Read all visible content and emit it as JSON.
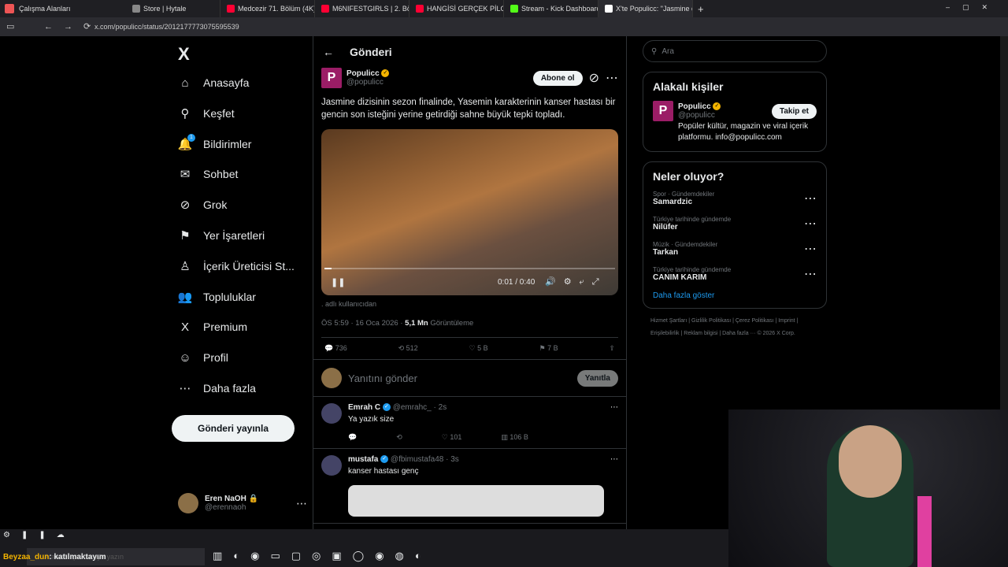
{
  "browser": {
    "workspaces_label": "Çalışma Alanları",
    "tabs": [
      {
        "label": "Store | Hytale",
        "color": "#888888"
      },
      {
        "label": "Medcezir 71. Bölüm (4K) - Y",
        "color": "#ff0033"
      },
      {
        "label": "M6NIFESTGIRLS | 2. Bölüm",
        "color": "#ff0033"
      },
      {
        "label": "HANGİSİ GERÇEK PİLOT?! ft",
        "color": "#ff0033"
      },
      {
        "label": "Stream - Kick Dashboard",
        "color": "#53fc18"
      },
      {
        "label": "X'te Populicc: \"Jasmine dizi",
        "color": "#ffffff"
      }
    ],
    "url": "x.com/populicc/status/2012177773075595539"
  },
  "sidebar": {
    "logo": "X",
    "items": [
      {
        "label": "Anasayfa",
        "icon": "⌂"
      },
      {
        "label": "Keşfet",
        "icon": "⚲"
      },
      {
        "label": "Bildirimler",
        "icon": "🔔"
      },
      {
        "label": "Sohbet",
        "icon": "✉"
      },
      {
        "label": "Grok",
        "icon": "⊘"
      },
      {
        "label": "Yer İşaretleri",
        "icon": "⚑"
      },
      {
        "label": "İçerik Üreticisi St...",
        "icon": "♙"
      },
      {
        "label": "Topluluklar",
        "icon": "👥"
      },
      {
        "label": "Premium",
        "icon": "X"
      },
      {
        "label": "Profil",
        "icon": "☺"
      },
      {
        "label": "Daha fazla",
        "icon": "⋯"
      }
    ],
    "notification_count": "1",
    "post_button": "Gönderi yayınla",
    "user": {
      "name": "Eren NaOH 🔒",
      "handle": "@erennaoh"
    }
  },
  "main": {
    "title": "Gönderi",
    "tweet": {
      "name": "Populicc",
      "handle": "@populicc",
      "subscribe_button": "Abone ol",
      "text": "Jasmine dizisinin sezon finalinde, Yasemin karakterinin kanser hastası bir gencin son isteğini yerine getirdiği sahne büyük tepki topladı.",
      "video_time": "0:01 / 0:40",
      "video_progress": 0.025,
      "attribution": ". adlı kullanıcıdan",
      "timestamp": "ÖS 5:59 · 16 Oca 2026 · ",
      "views": "5,1 Mn",
      "views_label": "Görüntüleme",
      "replies": "736",
      "reposts": "512",
      "likes": "5 B",
      "bookmarks": "7 B"
    },
    "reply_placeholder": "Yanıtını gönder",
    "reply_button": "Yanıtla",
    "comments": [
      {
        "name": "Emrah C",
        "handle": "@emrahc_ · 2s",
        "text": "Ya yazık size",
        "likes": "101",
        "views": "106 B"
      },
      {
        "name": "mustafa",
        "handle": "@fbimustafa48 · 3s",
        "text": "kanser hastası genç"
      }
    ]
  },
  "right": {
    "search_placeholder": "Ara",
    "related_title": "Alakalı kişiler",
    "related": {
      "name": "Populicc",
      "handle": "@populicc",
      "follow_button": "Takip et",
      "bio": "Popüler kültür, magazin ve viral içerik platformu. info@populicc.com"
    },
    "trends_title": "Neler oluyor?",
    "trends": [
      {
        "category": "Spor · Gündemdekiler",
        "name": "Samardzic"
      },
      {
        "category": "Türkiye tarihinde gündemde",
        "name": "Nilüfer"
      },
      {
        "category": "Müzik · Gündemdekiler",
        "name": "Tarkan"
      },
      {
        "category": "Türkiye tarihinde gündemde",
        "name": "CANIM KARIM"
      }
    ],
    "show_more": "Daha fazla göster",
    "footer": "Hizmet Şartları | Gizlilik Politikası | Çerez Politikası | Imprint | Erişilebilirlik | Reklam bilgisi | Daha fazla ··· © 2026 X Corp."
  },
  "taskbar": {
    "chat_user": "Beyzaa_dun",
    "chat_text": ": katılmaktayım",
    "search_placeholder": "Aramak için buraya yazın"
  }
}
